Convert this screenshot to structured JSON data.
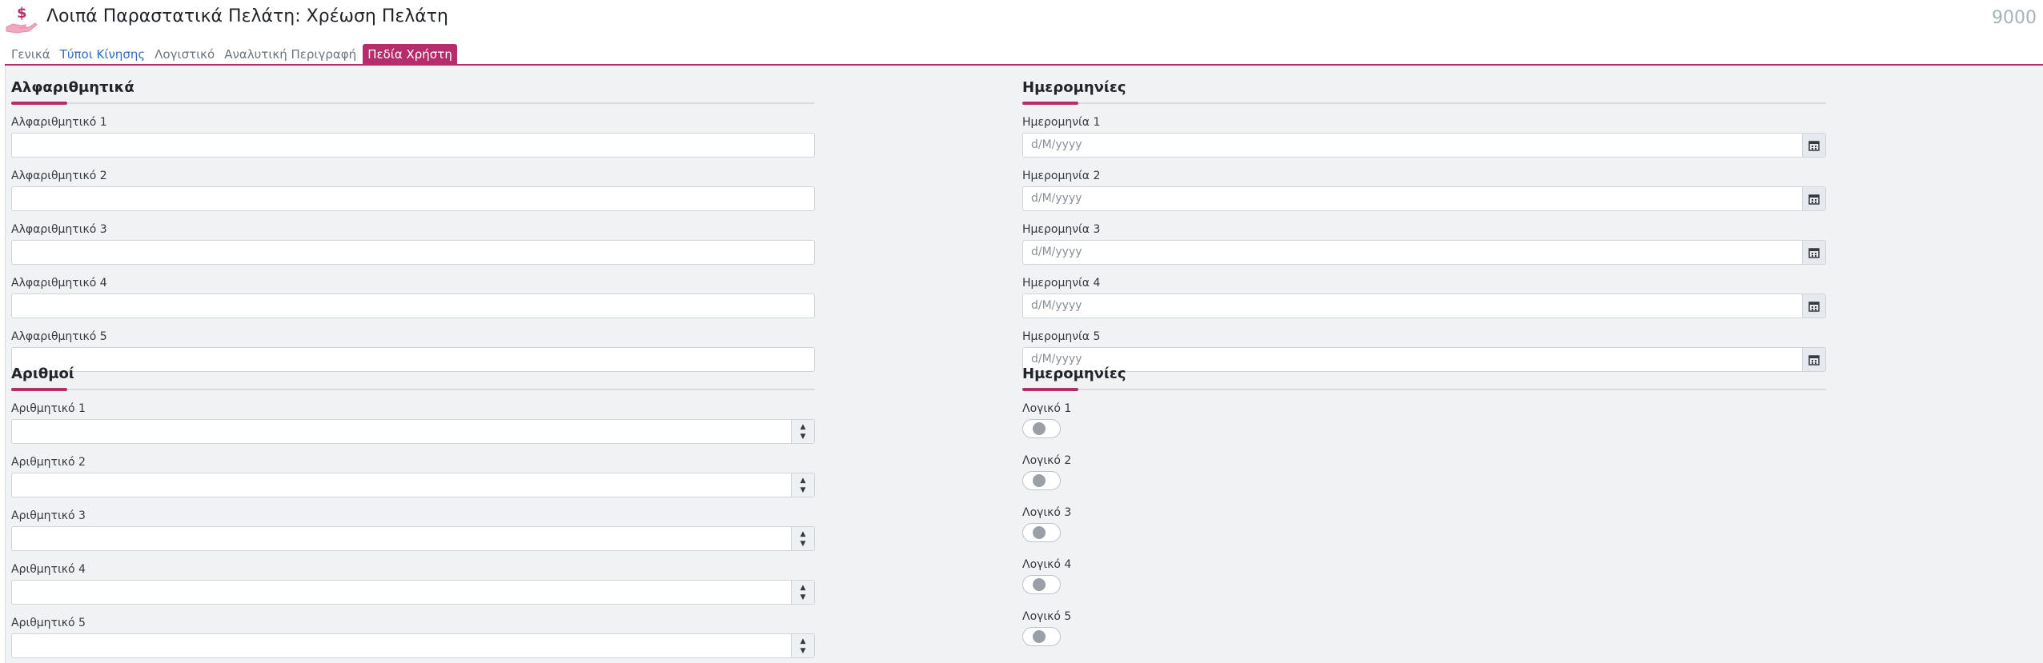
{
  "header": {
    "title": "Λοιπά Παραστατικά Πελάτη: Χρέωση Πελάτη",
    "doc_number": "9000",
    "logo_icon": "hand-dollar-icon"
  },
  "tabs": [
    {
      "label": "Γενικά"
    },
    {
      "label": "Τύποι Κίνησης"
    },
    {
      "label": "Λογιστικό"
    },
    {
      "label": "Αναλυτική Περιγραφή"
    },
    {
      "label": "Πεδία Χρήστη"
    }
  ],
  "sections": {
    "alpha": {
      "title": "Αλφαριθμητικά",
      "fields": [
        {
          "label": "Αλφαριθμητικό 1",
          "value": ""
        },
        {
          "label": "Αλφαριθμητικό 2",
          "value": ""
        },
        {
          "label": "Αλφαριθμητικό 3",
          "value": ""
        },
        {
          "label": "Αλφαριθμητικό 4",
          "value": ""
        },
        {
          "label": "Αλφαριθμητικό 5",
          "value": ""
        }
      ]
    },
    "dates": {
      "title": "Ημερομηνίες",
      "fields": [
        {
          "label": "Ημερομηνία 1",
          "placeholder": "d/M/yyyy"
        },
        {
          "label": "Ημερομηνία 2",
          "placeholder": "d/M/yyyy"
        },
        {
          "label": "Ημερομηνία 3",
          "placeholder": "d/M/yyyy"
        },
        {
          "label": "Ημερομηνία 4",
          "placeholder": "d/M/yyyy"
        },
        {
          "label": "Ημερομηνία 5",
          "placeholder": "d/M/yyyy"
        }
      ]
    },
    "numbers": {
      "title": "Αριθμοί",
      "fields": [
        {
          "label": "Αριθμητικό 1",
          "value": ""
        },
        {
          "label": "Αριθμητικό 2",
          "value": ""
        },
        {
          "label": "Αριθμητικό 3",
          "value": ""
        },
        {
          "label": "Αριθμητικό 4",
          "value": ""
        },
        {
          "label": "Αριθμητικό 5",
          "value": ""
        }
      ]
    },
    "logicals": {
      "title": "Ημερομηνίες",
      "fields": [
        {
          "label": "Λογικό 1",
          "checked": false
        },
        {
          "label": "Λογικό 2",
          "checked": false
        },
        {
          "label": "Λογικό 3",
          "checked": false
        },
        {
          "label": "Λογικό 4",
          "checked": false
        },
        {
          "label": "Λογικό 5",
          "checked": false
        }
      ]
    }
  },
  "colors": {
    "accent": "#b52e6b",
    "link": "#2f6ec2",
    "background": "#f0f2f4"
  },
  "icons": {
    "calendar": "calendar-icon",
    "spin_up": "spin-up-icon",
    "spin_down": "spin-down-icon"
  }
}
